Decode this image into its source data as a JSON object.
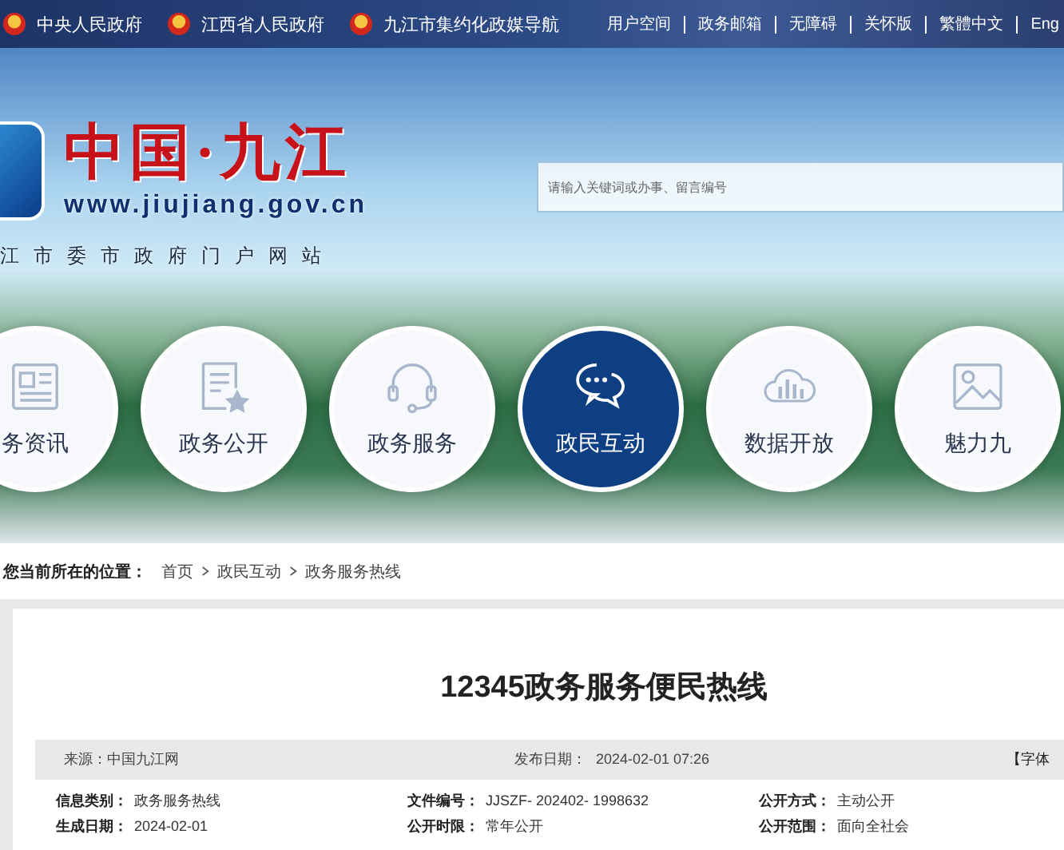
{
  "top_bar": {
    "gov_links": [
      "中央人民政府",
      "江西省人民政府",
      "九江市集约化政媒导航"
    ],
    "utility_links": [
      "用户空间",
      "政务邮箱",
      "无障碍",
      "关怀版",
      "繁體中文",
      "Eng"
    ]
  },
  "header": {
    "logo_title": "中国·九江",
    "logo_url": "www.jiujiang.gov.cn",
    "logo_subtitle": "江市委市政府门户网站",
    "search": {
      "placeholder": "请输入关键词或办事、留言编号"
    }
  },
  "nav": [
    {
      "label": "务资讯",
      "kind": "news",
      "selected": false
    },
    {
      "label": "政务公开",
      "kind": "document",
      "selected": false
    },
    {
      "label": "政务服务",
      "kind": "headset",
      "selected": false
    },
    {
      "label": "政民互动",
      "kind": "chat",
      "selected": true
    },
    {
      "label": "数据开放",
      "kind": "cloud",
      "selected": false
    },
    {
      "label": "魅力九",
      "kind": "image",
      "selected": false
    }
  ],
  "breadcrumb": {
    "label": "您当前所在的位置：",
    "items": [
      "首页",
      "政民互动",
      "政务服务热线"
    ]
  },
  "article": {
    "title": "12345政务服务便民热线",
    "meta": {
      "source_label": "来源：",
      "source": "中国九江网",
      "date_label": "发布日期：",
      "date": "2024-02-01 07:26",
      "font_label": "【字体"
    },
    "info": [
      {
        "label": "信息类别：",
        "value": "政务服务热线"
      },
      {
        "label": "文件编号：",
        "value": "JJSZF- 202402- 1998632"
      },
      {
        "label": "公开方式：",
        "value": "主动公开"
      },
      {
        "label": "生成日期：",
        "value": "2024-02-01"
      },
      {
        "label": "公开时限：",
        "value": "常年公开"
      },
      {
        "label": "公开范围：",
        "value": "面向全社会"
      }
    ]
  }
}
